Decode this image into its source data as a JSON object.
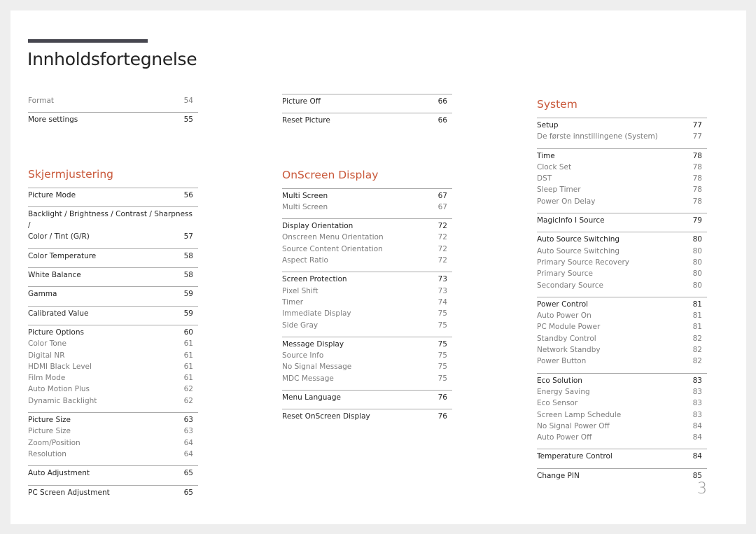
{
  "title": "Innholdsfortegnelse",
  "page_number": "3",
  "accent_color": "#c9593b",
  "columns": [
    {
      "sections": [
        {
          "heading": null,
          "groups": [
            {
              "entries": [
                {
                  "label": "Format",
                  "page": "54",
                  "main": false
                }
              ],
              "first": true
            },
            {
              "entries": [
                {
                  "label": "More settings",
                  "page": "55",
                  "main": true
                }
              ]
            }
          ]
        },
        {
          "heading": "Skjermjustering",
          "groups": [
            {
              "entries": [
                {
                  "label": "Picture Mode",
                  "page": "56",
                  "main": true
                }
              ]
            },
            {
              "entries": [
                {
                  "label": "Backlight / Brightness / Contrast / Sharpness /",
                  "page": "",
                  "main": true
                },
                {
                  "label": "Color / Tint (G/R)",
                  "page": "57",
                  "main": true
                }
              ]
            },
            {
              "entries": [
                {
                  "label": "Color Temperature",
                  "page": "58",
                  "main": true
                }
              ]
            },
            {
              "entries": [
                {
                  "label": "White Balance",
                  "page": "58",
                  "main": true
                }
              ]
            },
            {
              "entries": [
                {
                  "label": "Gamma",
                  "page": "59",
                  "main": true
                }
              ]
            },
            {
              "entries": [
                {
                  "label": "Calibrated Value",
                  "page": "59",
                  "main": true
                }
              ]
            },
            {
              "entries": [
                {
                  "label": "Picture Options",
                  "page": "60",
                  "main": true
                },
                {
                  "label": "Color Tone",
                  "page": "61",
                  "main": false
                },
                {
                  "label": "Digital NR",
                  "page": "61",
                  "main": false
                },
                {
                  "label": "HDMI Black Level",
                  "page": "61",
                  "main": false
                },
                {
                  "label": "Film Mode",
                  "page": "61",
                  "main": false
                },
                {
                  "label": "Auto Motion Plus",
                  "page": "62",
                  "main": false
                },
                {
                  "label": "Dynamic Backlight",
                  "page": "62",
                  "main": false
                }
              ]
            },
            {
              "entries": [
                {
                  "label": "Picture Size",
                  "page": "63",
                  "main": true
                },
                {
                  "label": "Picture Size",
                  "page": "63",
                  "main": false
                },
                {
                  "label": "Zoom/Position",
                  "page": "64",
                  "main": false
                },
                {
                  "label": "Resolution",
                  "page": "64",
                  "main": false
                }
              ]
            },
            {
              "entries": [
                {
                  "label": "Auto Adjustment",
                  "page": "65",
                  "main": true
                }
              ]
            },
            {
              "entries": [
                {
                  "label": "PC Screen Adjustment",
                  "page": "65",
                  "main": true
                }
              ]
            }
          ]
        }
      ]
    },
    {
      "sections": [
        {
          "heading": null,
          "groups": [
            {
              "entries": [
                {
                  "label": "Picture Off",
                  "page": "66",
                  "main": true
                }
              ]
            },
            {
              "entries": [
                {
                  "label": "Reset Picture",
                  "page": "66",
                  "main": true
                }
              ]
            }
          ]
        },
        {
          "heading": "OnScreen Display",
          "groups": [
            {
              "entries": [
                {
                  "label": "Multi Screen",
                  "page": "67",
                  "main": true
                },
                {
                  "label": "Multi Screen",
                  "page": "67",
                  "main": false
                }
              ]
            },
            {
              "entries": [
                {
                  "label": "Display Orientation",
                  "page": "72",
                  "main": true
                },
                {
                  "label": "Onscreen Menu Orientation",
                  "page": "72",
                  "main": false
                },
                {
                  "label": "Source Content Orientation",
                  "page": "72",
                  "main": false
                },
                {
                  "label": "Aspect Ratio",
                  "page": "72",
                  "main": false
                }
              ]
            },
            {
              "entries": [
                {
                  "label": "Screen Protection",
                  "page": "73",
                  "main": true
                },
                {
                  "label": "Pixel Shift",
                  "page": "73",
                  "main": false
                },
                {
                  "label": "Timer",
                  "page": "74",
                  "main": false
                },
                {
                  "label": "Immediate Display",
                  "page": "75",
                  "main": false
                },
                {
                  "label": "Side Gray",
                  "page": "75",
                  "main": false
                }
              ]
            },
            {
              "entries": [
                {
                  "label": "Message Display",
                  "page": "75",
                  "main": true
                },
                {
                  "label": "Source Info",
                  "page": "75",
                  "main": false
                },
                {
                  "label": "No Signal Message",
                  "page": "75",
                  "main": false
                },
                {
                  "label": "MDC Message",
                  "page": "75",
                  "main": false
                }
              ]
            },
            {
              "entries": [
                {
                  "label": "Menu Language",
                  "page": "76",
                  "main": true
                }
              ]
            },
            {
              "entries": [
                {
                  "label": "Reset OnScreen Display",
                  "page": "76",
                  "main": true
                }
              ]
            }
          ]
        }
      ]
    },
    {
      "sections": [
        {
          "heading": "System",
          "groups": [
            {
              "entries": [
                {
                  "label": "Setup",
                  "page": "77",
                  "main": true
                },
                {
                  "label": "De første innstillingene (System)",
                  "page": "77",
                  "main": false
                }
              ]
            },
            {
              "entries": [
                {
                  "label": "Time",
                  "page": "78",
                  "main": true
                },
                {
                  "label": "Clock Set",
                  "page": "78",
                  "main": false
                },
                {
                  "label": "DST",
                  "page": "78",
                  "main": false
                },
                {
                  "label": "Sleep Timer",
                  "page": "78",
                  "main": false
                },
                {
                  "label": "Power On Delay",
                  "page": "78",
                  "main": false
                }
              ]
            },
            {
              "entries": [
                {
                  "label": "MagicInfo I Source",
                  "page": "79",
                  "main": true
                }
              ]
            },
            {
              "entries": [
                {
                  "label": "Auto Source Switching",
                  "page": "80",
                  "main": true
                },
                {
                  "label": "Auto Source Switching",
                  "page": "80",
                  "main": false
                },
                {
                  "label": "Primary Source Recovery",
                  "page": "80",
                  "main": false
                },
                {
                  "label": "Primary Source",
                  "page": "80",
                  "main": false
                },
                {
                  "label": "Secondary Source",
                  "page": "80",
                  "main": false
                }
              ]
            },
            {
              "entries": [
                {
                  "label": "Power Control",
                  "page": "81",
                  "main": true
                },
                {
                  "label": "Auto Power On",
                  "page": "81",
                  "main": false
                },
                {
                  "label": "PC Module Power",
                  "page": "81",
                  "main": false
                },
                {
                  "label": "Standby Control",
                  "page": "82",
                  "main": false
                },
                {
                  "label": "Network Standby",
                  "page": "82",
                  "main": false
                },
                {
                  "label": "Power Button",
                  "page": "82",
                  "main": false
                }
              ]
            },
            {
              "entries": [
                {
                  "label": "Eco Solution",
                  "page": "83",
                  "main": true
                },
                {
                  "label": "Energy Saving",
                  "page": "83",
                  "main": false
                },
                {
                  "label": "Eco Sensor",
                  "page": "83",
                  "main": false
                },
                {
                  "label": "Screen Lamp Schedule",
                  "page": "83",
                  "main": false
                },
                {
                  "label": "No Signal Power Off",
                  "page": "84",
                  "main": false
                },
                {
                  "label": "Auto Power Off",
                  "page": "84",
                  "main": false
                }
              ]
            },
            {
              "entries": [
                {
                  "label": "Temperature Control",
                  "page": "84",
                  "main": true
                }
              ]
            },
            {
              "entries": [
                {
                  "label": "Change PIN",
                  "page": "85",
                  "main": true
                }
              ]
            }
          ]
        }
      ]
    }
  ]
}
